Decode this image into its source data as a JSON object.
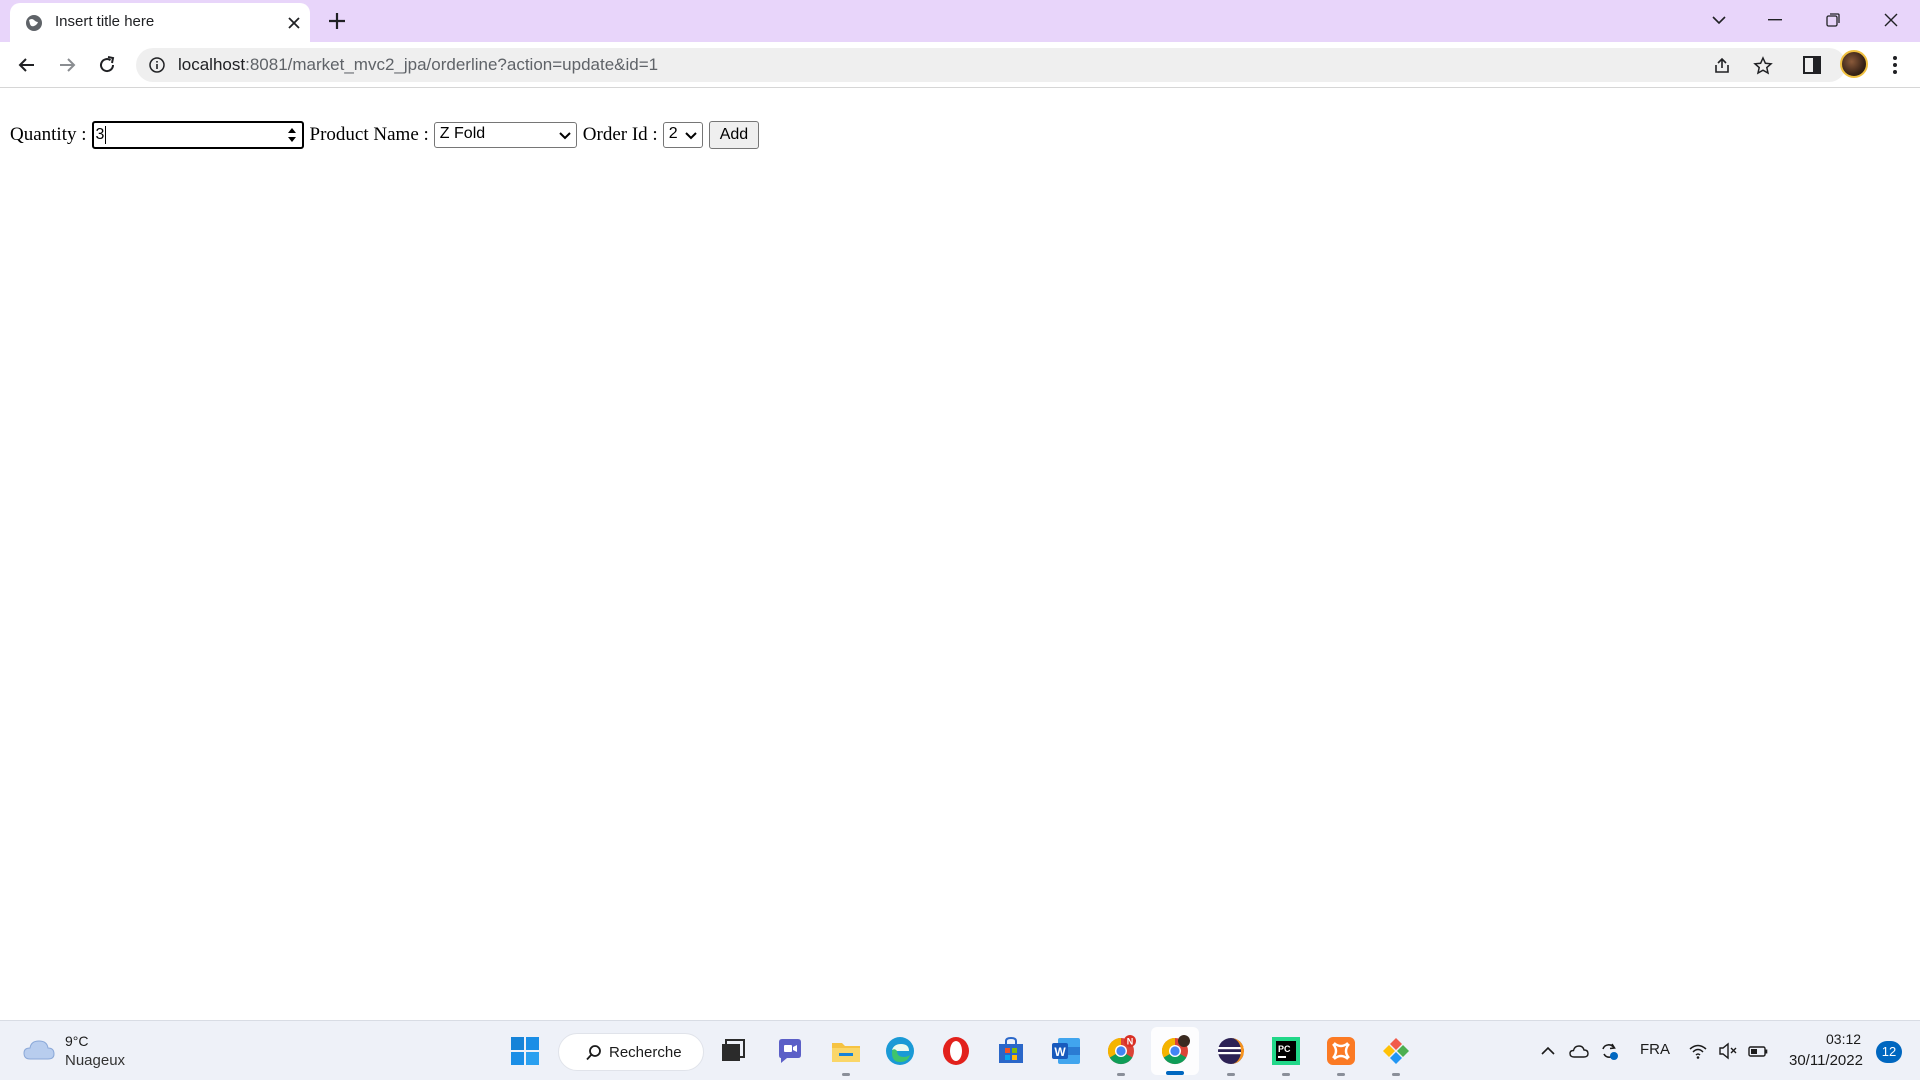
{
  "browser": {
    "tab_title": "Insert title here",
    "url_host": "localhost",
    "url_rest": ":8081/market_mvc2_jpa/orderline?action=update&id=1"
  },
  "form": {
    "quantity_label": "Quantity :",
    "quantity_value": "3",
    "product_label": "Product Name :",
    "product_selected": "Z Fold",
    "order_label": "Order Id :",
    "order_selected": "2",
    "add_label": "Add"
  },
  "taskbar": {
    "weather_temp": "9°C",
    "weather_desc": "Nuageux",
    "search_label": "Recherche",
    "language": "FRA",
    "time": "03:12",
    "date": "30/11/2022",
    "notification_count": "12"
  },
  "colors": {
    "tabstrip": "#e8d5fa",
    "accent": "#0067c0"
  }
}
